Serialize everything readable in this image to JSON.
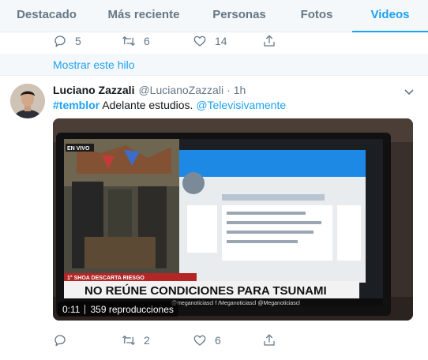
{
  "tabs": [
    {
      "label": "Destacado"
    },
    {
      "label": "Más reciente"
    },
    {
      "label": "Personas"
    },
    {
      "label": "Fotos"
    },
    {
      "label": "Videos",
      "active": true
    }
  ],
  "prev_tweet": {
    "actions": {
      "reply": "5",
      "retweet": "6",
      "like": "14"
    }
  },
  "thread_link": "Mostrar este hilo",
  "tweet": {
    "name": "Luciano Zazzali",
    "handle": "@LucianoZazzali",
    "separator": "·",
    "time": "1h",
    "hashtag": "#temblor",
    "text": " Adelante estudios. ",
    "mention": "@Televisivamente",
    "video": {
      "duration": "0:11",
      "views": "359 reproducciones",
      "tv_source": "EN VIVO",
      "tv_ticker": "1° SHOA DESCARTA RIESGO",
      "tv_headline": "NO REÚNE CONDICIONES PARA TSUNAMI",
      "tv_footer": "@meganoticiascl   f /Meganoticiascl   @Meganoticiascl"
    },
    "actions": {
      "reply": "",
      "retweet": "2",
      "like": "6"
    }
  },
  "colors": {
    "accent": "#1da1f2",
    "muted": "#657786",
    "tab_bg": "#f5f8fa",
    "divider": "#e6ecf0"
  },
  "icons": [
    "reply-icon",
    "retweet-icon",
    "like-icon",
    "share-icon",
    "chevron-down-icon"
  ]
}
